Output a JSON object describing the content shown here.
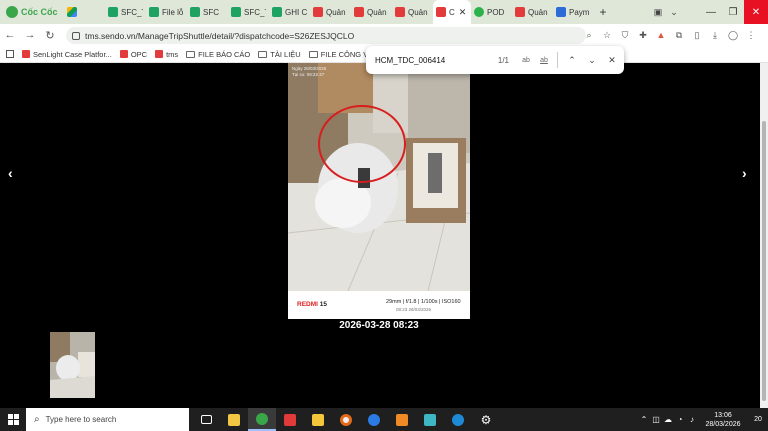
{
  "browser": {
    "brand": "Cốc Cốc",
    "tabs": [
      {
        "label": "",
        "favicon": "drive-icon",
        "color": "drive"
      },
      {
        "label": "SFC_T",
        "favicon": "sheets-icon",
        "color": "green"
      },
      {
        "label": "File lỗ",
        "favicon": "sheets-icon",
        "color": "green"
      },
      {
        "label": "SFC",
        "favicon": "sheets-icon",
        "color": "green"
      },
      {
        "label": "SFC_T",
        "favicon": "sheets-icon",
        "color": "green"
      },
      {
        "label": "GHI C",
        "favicon": "sheets-icon",
        "color": "green"
      },
      {
        "label": "Quản",
        "favicon": "sendo-icon",
        "color": "red"
      },
      {
        "label": "Quản",
        "favicon": "sendo-icon",
        "color": "red"
      },
      {
        "label": "Quản",
        "favicon": "sendo-icon",
        "color": "red"
      }
    ],
    "active_tab": {
      "label": "C",
      "favicon": "sendo-icon"
    },
    "tabs_after": [
      {
        "label": "POD",
        "favicon": "pod-icon",
        "color": "sgreen"
      },
      {
        "label": "Quản",
        "favicon": "sendo-icon",
        "color": "red"
      },
      {
        "label": "Paym",
        "favicon": "p-icon",
        "color": "blue"
      }
    ],
    "new_tab": "+",
    "url": "tms.sendo.vn/ManageTripShuttle/detail/?dispatchcode=S26ZESJQCLO"
  },
  "bookmarks": [
    {
      "label": "SenLight Case Platfor...",
      "kind": "site",
      "color": "#e33b3b"
    },
    {
      "label": "OPC",
      "kind": "site",
      "color": "#e33b3b"
    },
    {
      "label": "tms",
      "kind": "site",
      "color": "#e33b3b"
    },
    {
      "label": "FILE BÁO CÁO",
      "kind": "folder"
    },
    {
      "label": "TÀI LIỆU",
      "kind": "folder"
    },
    {
      "label": "FILE CÔNG VIỆC",
      "kind": "folder"
    }
  ],
  "find": {
    "query": "HCM_TDC_006414",
    "count": "1/1",
    "opt_case": "ab",
    "opt_word": "ab"
  },
  "viewer": {
    "prev": "‹",
    "next": "›",
    "caption": "2026-03-28 08:23",
    "photo_stamp_line1": "Ngày 28/03/2026",
    "photo_stamp_line2": "Tại so: 08:22:47",
    "photo_brand": "REDMI",
    "photo_model": "15",
    "photo_specs": "29mm | f/1.8 | 1/100s | ISO160",
    "photo_date": "08:23 28/03/2026"
  },
  "taskbar": {
    "search_placeholder": "Type here to search",
    "time": "13:06",
    "date": "28/03/2026",
    "notifications": "20"
  }
}
